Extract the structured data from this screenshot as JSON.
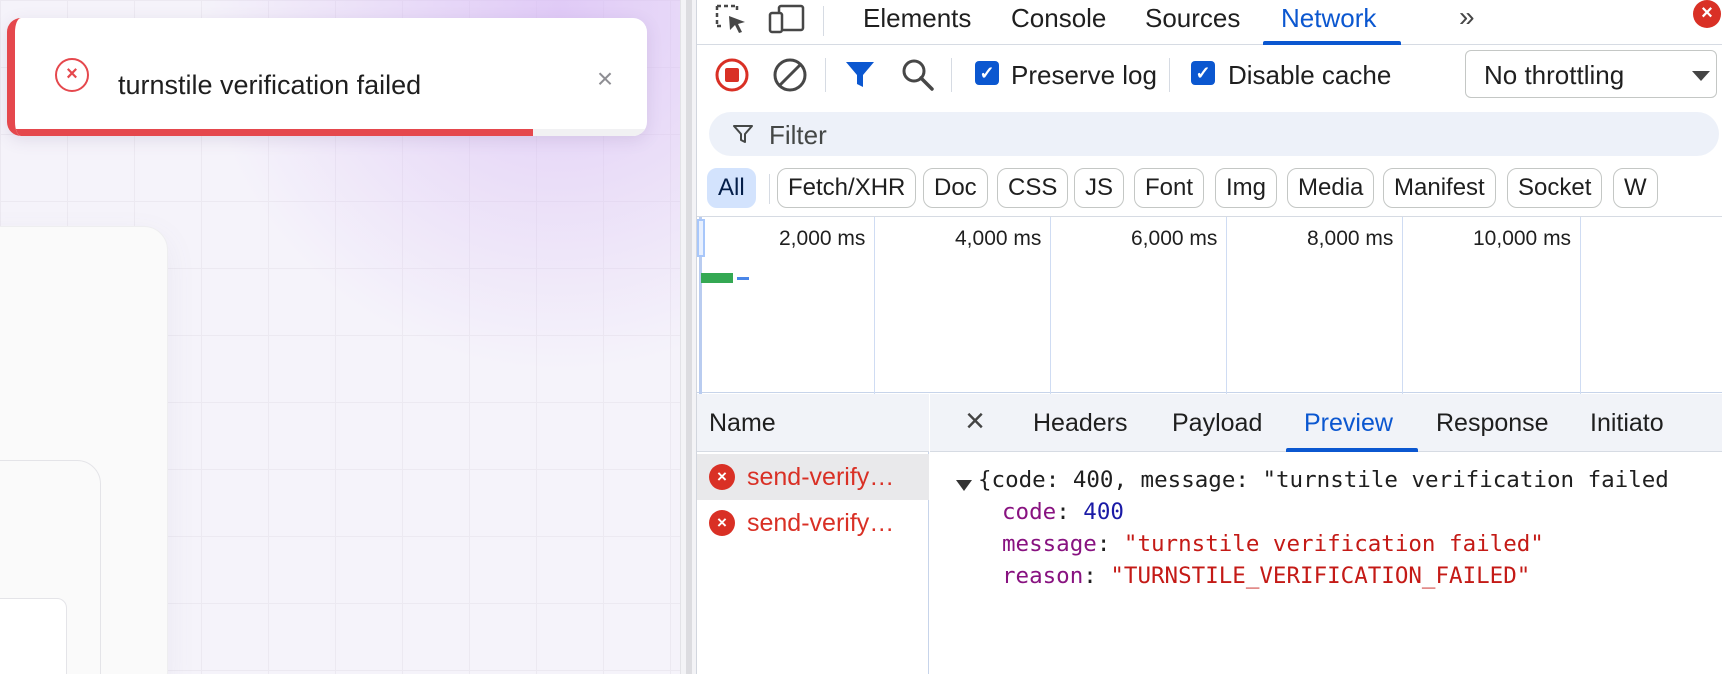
{
  "toast": {
    "message": "turnstile verification failed",
    "close_symbol": "×",
    "progress_fraction": 0.82,
    "accent_color": "#e5484d"
  },
  "devtools": {
    "tabs": [
      {
        "label": "Elements",
        "active": false
      },
      {
        "label": "Console",
        "active": false
      },
      {
        "label": "Sources",
        "active": false
      },
      {
        "label": "Network",
        "active": true
      }
    ],
    "more_tabs_symbol": "»",
    "close_symbol": "×",
    "toolbar": {
      "preserve_log_label": "Preserve log",
      "preserve_log_checked": true,
      "disable_cache_label": "Disable cache",
      "disable_cache_checked": true,
      "throttling_value": "No throttling"
    },
    "filter_placeholder": "Filter",
    "type_filters": [
      "All",
      "Fetch/XHR",
      "Doc",
      "CSS",
      "JS",
      "Font",
      "Img",
      "Media",
      "Manifest",
      "Socket",
      "W"
    ],
    "active_type_filter": "All",
    "overview": {
      "tick_labels": [
        "2,000 ms",
        "4,000 ms",
        "6,000 ms",
        "8,000 ms",
        "10,000 ms"
      ]
    },
    "requests": {
      "column_header": "Name",
      "rows": [
        {
          "name": "send-verify…",
          "status": "error",
          "selected": true
        },
        {
          "name": "send-verify…",
          "status": "error",
          "selected": false
        }
      ]
    },
    "detail": {
      "close_symbol": "×",
      "tabs": [
        {
          "label": "Headers",
          "active": false
        },
        {
          "label": "Payload",
          "active": false
        },
        {
          "label": "Preview",
          "active": true
        },
        {
          "label": "Response",
          "active": false
        },
        {
          "label": "Initiato",
          "active": false
        }
      ],
      "preview": {
        "summary": "{code: 400, message: \"turnstile verification failed",
        "fields": [
          {
            "key": "code",
            "value": "400",
            "type": "number"
          },
          {
            "key": "message",
            "value": "\"turnstile verification failed\"",
            "type": "string"
          },
          {
            "key": "reason",
            "value": "\"TURNSTILE_VERIFICATION_FAILED\"",
            "type": "string"
          }
        ]
      }
    },
    "colors": {
      "accent_blue": "#0b57d0",
      "error_red": "#d93025",
      "chip_active_bg": "#d3e3fd"
    }
  }
}
